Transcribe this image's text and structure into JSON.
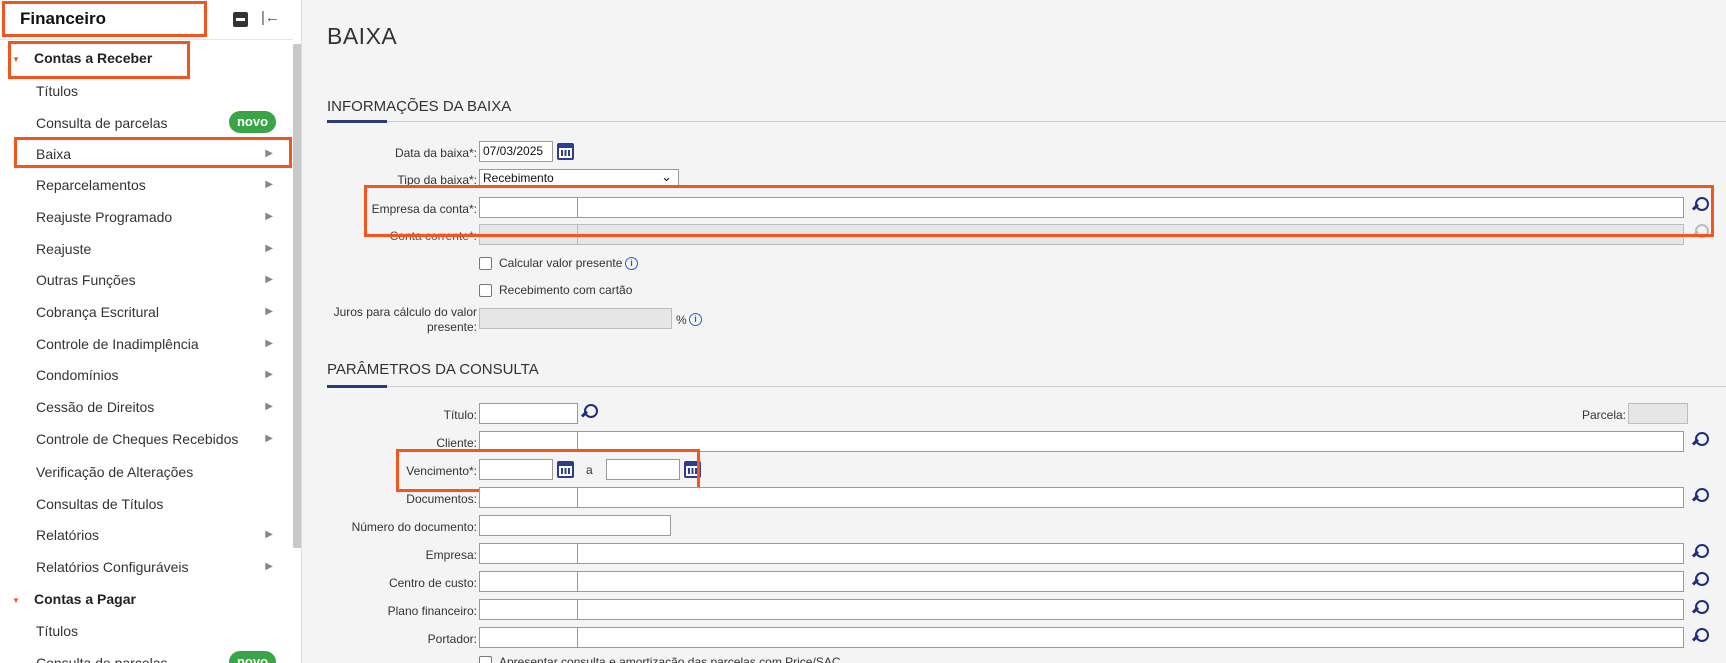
{
  "sidebar": {
    "title": "Financeiro",
    "groups": [
      {
        "label": "Contas a Receber",
        "items": [
          {
            "label": "Títulos"
          },
          {
            "label": "Consulta de parcelas",
            "badge": "novo"
          },
          {
            "label": "Baixa"
          },
          {
            "label": "Reparcelamentos"
          },
          {
            "label": "Reajuste Programado"
          },
          {
            "label": "Reajuste"
          },
          {
            "label": "Outras Funções"
          },
          {
            "label": "Cobrança Escritural"
          },
          {
            "label": "Controle de Inadimplência"
          },
          {
            "label": "Condomínios"
          },
          {
            "label": "Cessão de Direitos"
          },
          {
            "label": "Controle de Cheques Recebidos"
          },
          {
            "label": "Verificação de Alterações"
          },
          {
            "label": "Consultas de Títulos"
          },
          {
            "label": "Relatórios"
          },
          {
            "label": "Relatórios Configuráveis"
          }
        ]
      },
      {
        "label": "Contas a Pagar",
        "items": [
          {
            "label": "Títulos"
          },
          {
            "label": "Consulta de parcelas",
            "badge": "novo"
          }
        ]
      }
    ]
  },
  "page": {
    "title": "BAIXA"
  },
  "info_section": {
    "title": "INFORMAÇÕES DA BAIXA",
    "data_baixa_label": "Data da baixa*:",
    "data_baixa_value": "07/03/2025",
    "tipo_baixa_label": "Tipo da baixa*:",
    "tipo_baixa_value": "Recebimento",
    "empresa_conta_label": "Empresa da conta*:",
    "conta_corrente_label": "Conta corrente*:",
    "calc_valor_presente_label": "Calcular valor presente",
    "receb_cartao_label": "Recebimento com cartão",
    "juros_label_1": "Juros para cálculo do valor",
    "juros_label_2": "presente:",
    "percent": "%"
  },
  "params_section": {
    "title": "PARÂMETROS DA CONSULTA",
    "titulo_label": "Título:",
    "parcela_label": "Parcela:",
    "cliente_label": "Cliente:",
    "vencimento_label": "Vencimento*:",
    "vencimento_sep": "a",
    "documentos_label": "Documentos:",
    "numero_documento_label": "Número do documento:",
    "empresa_label": "Empresa:",
    "centro_custo_label": "Centro de custo:",
    "plano_financeiro_label": "Plano financeiro:",
    "portador_label": "Portador:",
    "cutoff_option": "Apresentar consulta e amortização das parcelas com Price/SAC"
  },
  "colors": {
    "highlight": "#f2551e",
    "accent": "#2a3a7a",
    "badge": "#3aa548"
  }
}
